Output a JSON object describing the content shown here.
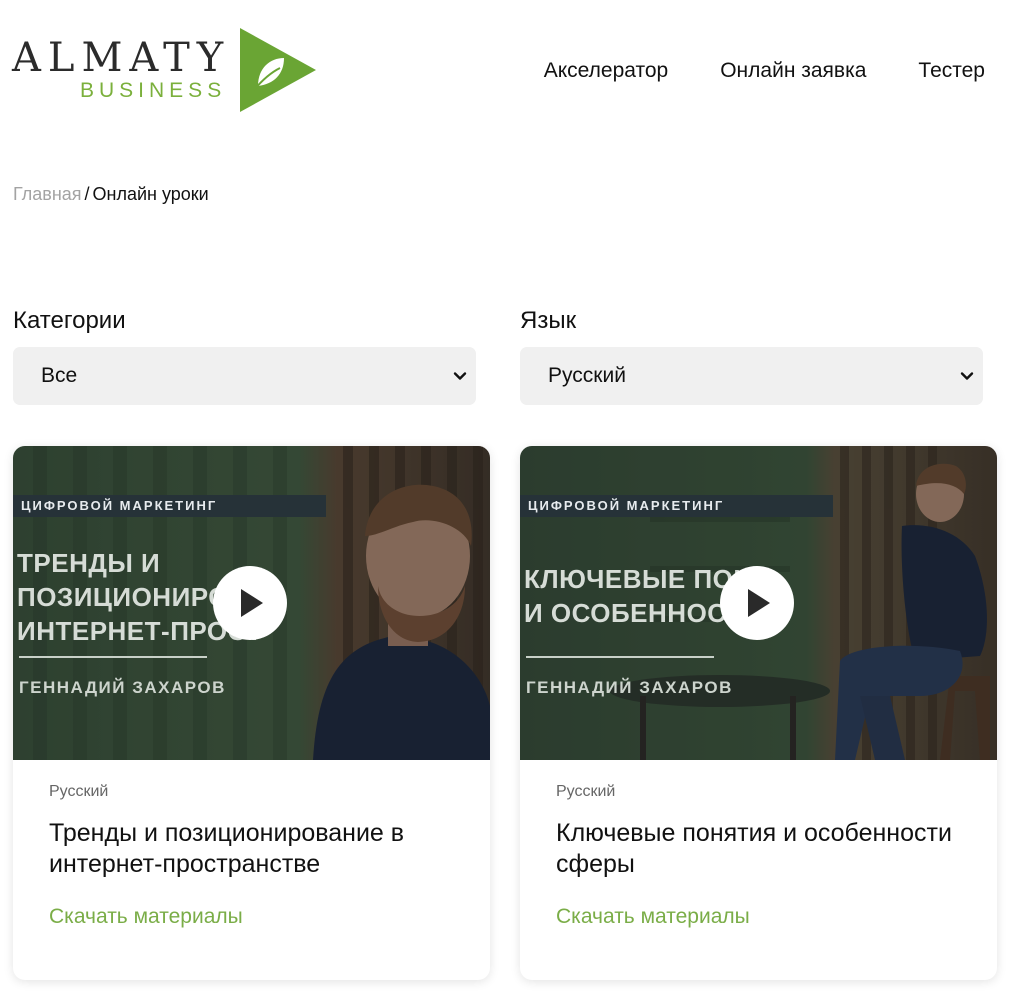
{
  "logo": {
    "line1": "ALMATY",
    "line2": "BUSINESS"
  },
  "nav": {
    "items": [
      {
        "label": "Акселератор"
      },
      {
        "label": "Онлайн заявка"
      },
      {
        "label": "Тестер"
      }
    ]
  },
  "breadcrumb": {
    "home": "Главная",
    "separator": "/",
    "current": "Онлайн уроки"
  },
  "filters": {
    "category": {
      "label": "Категории",
      "value": "Все"
    },
    "language": {
      "label": "Язык",
      "value": "Русский"
    }
  },
  "cards": [
    {
      "category_tag": "ЦИФРОВОЙ МАРКЕТИНГ",
      "thumb_title": "ТРЕНДЫ И\nПОЗИЦИОНИРОВ\nИНТЕРНЕТ-ПРОСТ",
      "thumb_author": "ГЕННАДИЙ ЗАХАРОВ",
      "language": "Русский",
      "title": "Тренды и позиционирование в интернет-пространстве",
      "link": "Скачать материалы"
    },
    {
      "category_tag": "ЦИФРОВОЙ МАРКЕТИНГ",
      "thumb_title": "КЛЮЧЕВЫЕ ПОНЯ\nИ ОСОБЕННОСТИ",
      "thumb_author": "ГЕННАДИЙ ЗАХАРОВ",
      "language": "Русский",
      "title": "Ключевые понятия и особенности сферы",
      "link": "Скачать материалы"
    }
  ],
  "colors": {
    "accent_green": "#7aad47",
    "logo_green": "#7bb03c",
    "select_bg": "#f0f0f0"
  },
  "icons": {
    "logo_mark": "green-triangle-leaf-icon",
    "select_arrow": "chevron-down-icon",
    "play": "play-icon"
  }
}
